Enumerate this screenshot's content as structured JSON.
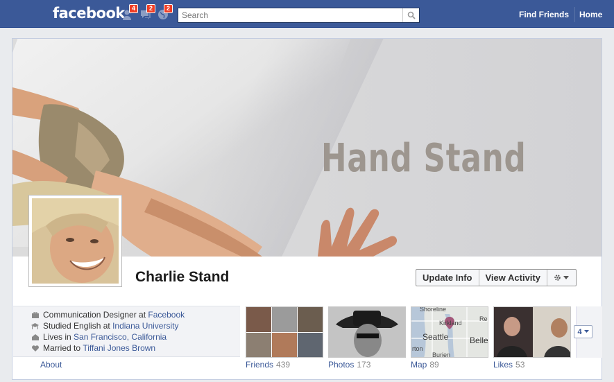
{
  "topbar": {
    "logo": "facebook",
    "friend_requests_count": "4",
    "messages_count": "2",
    "notifications_count": "2",
    "search_placeholder": "Search",
    "find_friends": "Find Friends",
    "home": "Home"
  },
  "cover": {
    "title": "Hand Stand"
  },
  "profile": {
    "name": "Charlie Stand",
    "update_info": "Update Info",
    "view_activity": "View Activity"
  },
  "info": {
    "work": {
      "prefix": "Communication Designer at",
      "link": "Facebook"
    },
    "study": {
      "prefix": "Studied English at",
      "link": "Indiana University"
    },
    "lives": {
      "prefix": "Lives in",
      "link": "San Francisco, California"
    },
    "married": {
      "prefix": "Married to",
      "link": "Tiffani Jones Brown"
    },
    "about": "About"
  },
  "tiles": {
    "friends": {
      "label": "Friends",
      "count": "439"
    },
    "photos": {
      "label": "Photos",
      "count": "173"
    },
    "map": {
      "label": "Map",
      "count": "89",
      "city_1": "Seattle",
      "city_2": "Belle",
      "place_1": "Shoreline",
      "place_2": "Kirkland",
      "place_3": "Burien",
      "place_4": "rton",
      "place_5": "Re"
    },
    "likes": {
      "label": "Likes",
      "count": "53"
    }
  },
  "more": {
    "count": "4"
  },
  "colors": {
    "brand": "#3b5998",
    "badge": "#f03d25"
  }
}
